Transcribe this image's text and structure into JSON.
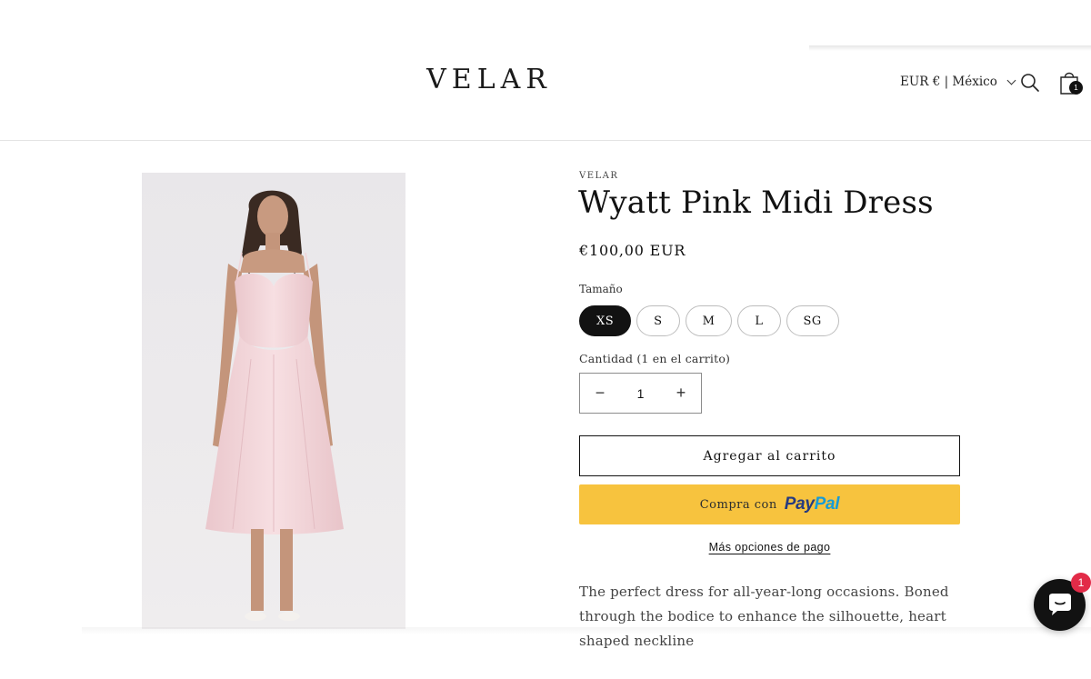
{
  "header": {
    "logo": "VELAR",
    "locale": "EUR € | México",
    "cart_count": "1"
  },
  "product": {
    "vendor": "VELAR",
    "title": "Wyatt Pink Midi Dress",
    "price": "€100,00 EUR",
    "size_label": "Tamaño",
    "sizes": [
      "XS",
      "S",
      "M",
      "L",
      "SG"
    ],
    "selected_size": "XS",
    "quantity_label": "Cantidad (1 en el carrito)",
    "quantity": "1",
    "quantity_minus": "−",
    "quantity_plus": "+",
    "add_to_cart": "Agregar al carrito",
    "paypal_prefix": "Compra con",
    "paypal_logo_a": "Pay",
    "paypal_logo_b": "Pal",
    "more_options": "Más opciones de pago",
    "description": "The perfect dress for all-year-long occasions. Boned through the bodice to enhance the silhouette, heart shaped neckline"
  },
  "chat": {
    "badge": "1"
  },
  "colors": {
    "paypal_yellow": "#f7c33e",
    "selected_size_bg": "#121212",
    "chat_badge": "#e22b48",
    "dress_pink": "#f3d6da"
  }
}
